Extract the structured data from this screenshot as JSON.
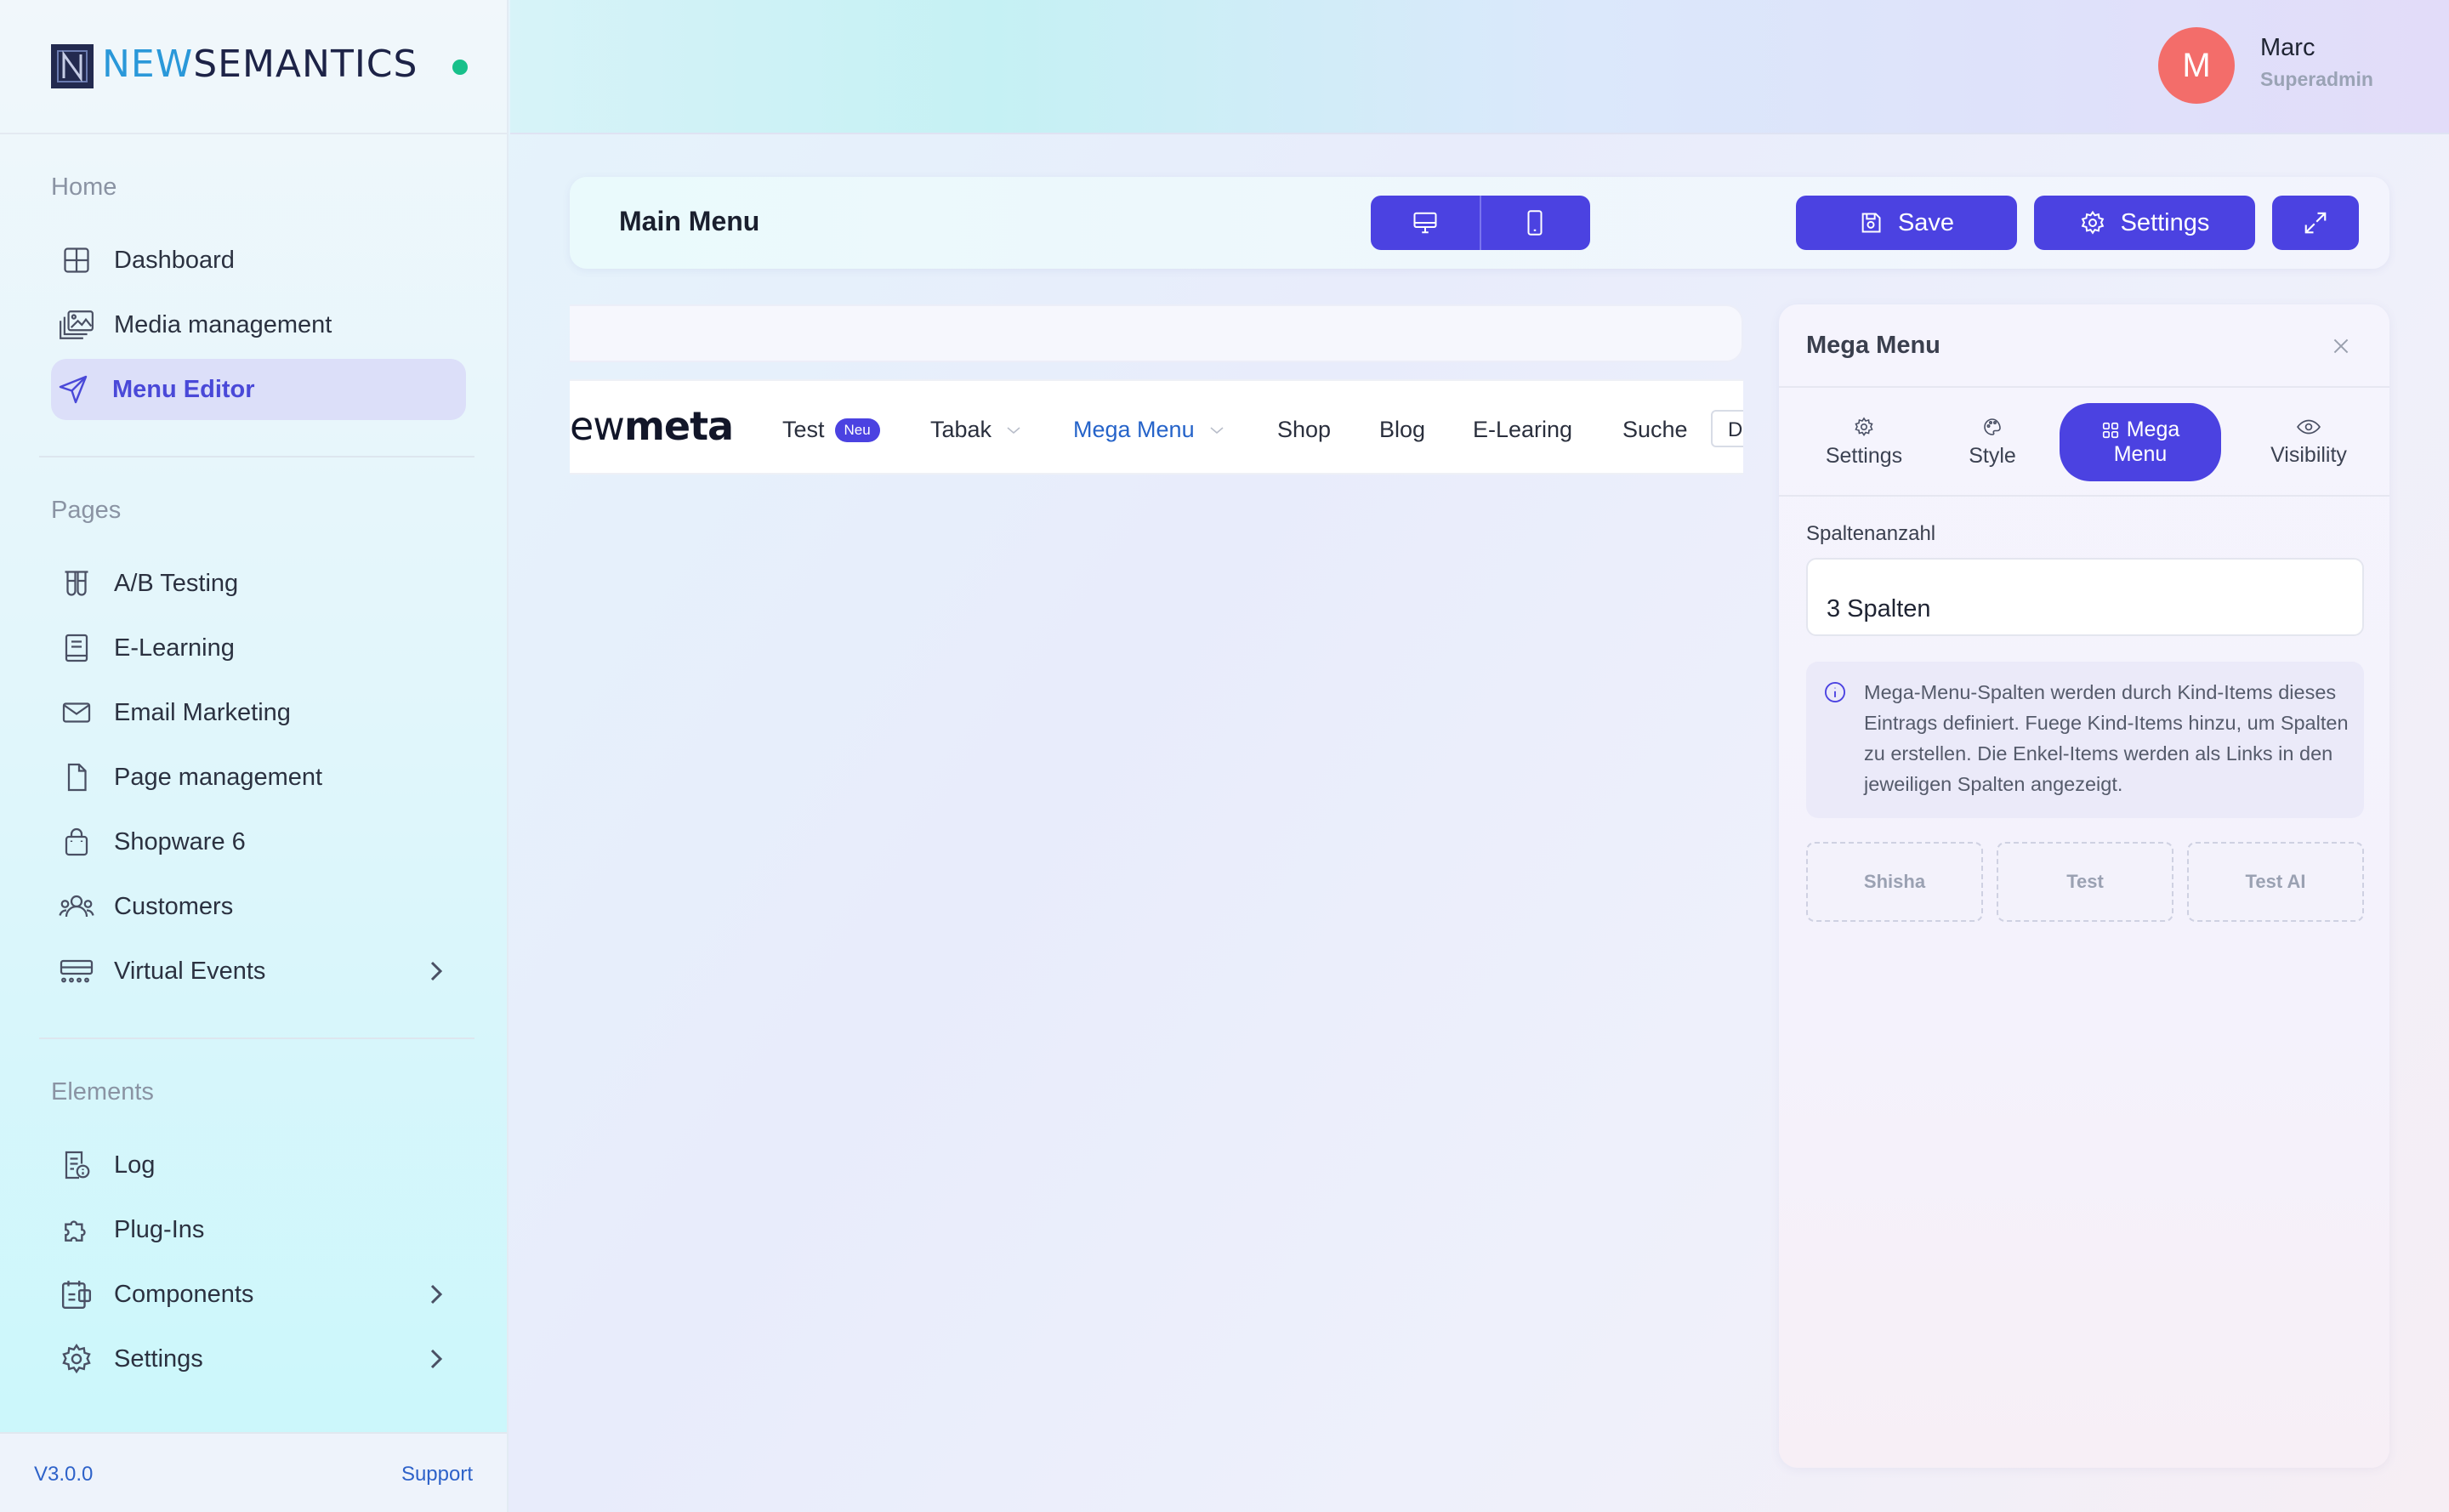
{
  "brand": {
    "name_part1": "NEW",
    "name_part2": "SEMANTICS",
    "logo_letter": "N"
  },
  "user": {
    "initial": "M",
    "name": "Marc",
    "role": "Superadmin"
  },
  "sidebar": {
    "sections": [
      {
        "label": "Home",
        "items": [
          {
            "label": "Dashboard",
            "icon": "dashboard-icon"
          },
          {
            "label": "Media management",
            "icon": "media-icon"
          },
          {
            "label": "Menu Editor",
            "icon": "send-icon",
            "active": true
          }
        ]
      },
      {
        "label": "Pages",
        "items": [
          {
            "label": "A/B Testing",
            "icon": "test-tubes-icon"
          },
          {
            "label": "E-Learning",
            "icon": "book-icon"
          },
          {
            "label": "Email Marketing",
            "icon": "mail-icon"
          },
          {
            "label": "Page management",
            "icon": "file-icon"
          },
          {
            "label": "Shopware 6",
            "icon": "shopping-bag-icon"
          },
          {
            "label": "Customers",
            "icon": "users-icon"
          },
          {
            "label": "Virtual Events",
            "icon": "event-icon",
            "has_children": true
          }
        ]
      },
      {
        "label": "Elements",
        "items": [
          {
            "label": "Log",
            "icon": "log-icon"
          },
          {
            "label": "Plug-Ins",
            "icon": "puzzle-icon"
          },
          {
            "label": "Components",
            "icon": "components-icon",
            "has_children": true
          },
          {
            "label": "Settings",
            "icon": "gear-icon",
            "has_children": true
          }
        ]
      }
    ],
    "version": "V3.0.0",
    "support_label": "Support"
  },
  "toolbar": {
    "title": "Main Menu",
    "save_label": "Save",
    "settings_label": "Settings"
  },
  "preview": {
    "logo_light": "ew",
    "logo_bold": "meta",
    "nav_items": [
      {
        "label": "Test",
        "badge": "Neu"
      },
      {
        "label": "Tabak",
        "has_dropdown": true
      },
      {
        "label": "Mega Menu",
        "has_dropdown": true,
        "active": true
      },
      {
        "label": "Shop"
      },
      {
        "label": "Blog"
      },
      {
        "label": "E-Learing"
      },
      {
        "label": "Suche"
      }
    ],
    "truncated_item": "D"
  },
  "panel": {
    "title": "Mega Menu",
    "tabs": [
      {
        "label": "Settings",
        "icon": "gear-icon"
      },
      {
        "label": "Style",
        "icon": "palette-icon"
      },
      {
        "label": "Mega",
        "label2": "Menu",
        "icon": "grid-icon",
        "active": true
      },
      {
        "label": "Visibility",
        "icon": "eye-icon"
      }
    ],
    "column_count_label": "Spaltenanzahl",
    "column_count_value": "3 Spalten",
    "info_text": "Mega-Menu-Spalten werden durch Kind-Items dieses Eintrags definiert. Fuege Kind-Items hinzu, um Spalten zu erstellen. Die Enkel-Items werden als Links in den jeweiligen Spalten angezeigt.",
    "columns": [
      "Shisha",
      "Test",
      "Test AI"
    ]
  },
  "colors": {
    "accent": "#4b42e1",
    "status_online": "#17c08a",
    "avatar": "#f36d6a",
    "link": "#2e62c9"
  }
}
